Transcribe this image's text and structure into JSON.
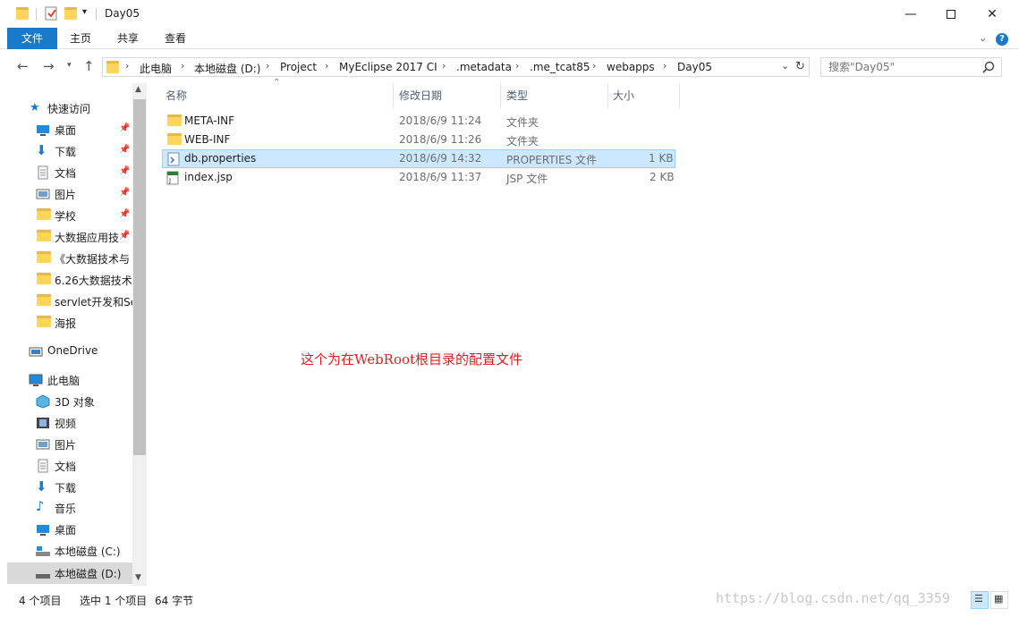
{
  "window": {
    "title": "Day05",
    "minimize_icon": "minimize-icon",
    "maximize_icon": "maximize-icon",
    "close_icon": "close-icon"
  },
  "ribbon": {
    "tabs": [
      {
        "label": "文件"
      },
      {
        "label": "主页"
      },
      {
        "label": "共享"
      },
      {
        "label": "查看"
      }
    ]
  },
  "address": {
    "crumbs": [
      "此电脑",
      "本地磁盘 (D:)",
      "Project",
      "MyEclipse 2017 CI",
      ".metadata",
      ".me_tcat85",
      "webapps",
      "Day05"
    ]
  },
  "search": {
    "placeholder": "搜索\"Day05\""
  },
  "sidebar": {
    "items": [
      {
        "label": "快速访问",
        "icon": "star-icon"
      },
      {
        "label": "桌面",
        "icon": "desktop-icon",
        "pinned": true
      },
      {
        "label": "下载",
        "icon": "download-icon",
        "pinned": true
      },
      {
        "label": "文档",
        "icon": "document-icon",
        "pinned": true
      },
      {
        "label": "图片",
        "icon": "picture-icon",
        "pinned": true
      },
      {
        "label": "学校",
        "icon": "folder-icon",
        "pinned": true
      },
      {
        "label": "大数据应用技",
        "icon": "folder-icon",
        "pinned": true
      },
      {
        "label": "《大数据技术与",
        "icon": "folder-icon"
      },
      {
        "label": "6.26大数据技术",
        "icon": "folder-icon"
      },
      {
        "label": "servlet开发和Se",
        "icon": "folder-icon"
      },
      {
        "label": "海报",
        "icon": "folder-icon"
      },
      {
        "label": "OneDrive",
        "icon": "cloud-icon"
      },
      {
        "label": "此电脑",
        "icon": "computer-icon"
      },
      {
        "label": "3D 对象",
        "icon": "cube-icon"
      },
      {
        "label": "视频",
        "icon": "video-icon"
      },
      {
        "label": "图片",
        "icon": "picture-icon"
      },
      {
        "label": "文档",
        "icon": "document-icon"
      },
      {
        "label": "下载",
        "icon": "download-icon"
      },
      {
        "label": "音乐",
        "icon": "music-icon"
      },
      {
        "label": "桌面",
        "icon": "desktop-icon"
      },
      {
        "label": "本地磁盘 (C:)",
        "icon": "drive-icon"
      },
      {
        "label": "本地磁盘 (D:)",
        "icon": "drive-icon"
      }
    ]
  },
  "columns": {
    "name": "名称",
    "modified": "修改日期",
    "type": "类型",
    "size": "大小"
  },
  "files": [
    {
      "name": "META-INF",
      "modified": "2018/6/9 11:24",
      "type": "文件夹",
      "size": ""
    },
    {
      "name": "WEB-INF",
      "modified": "2018/6/9 11:26",
      "type": "文件夹",
      "size": ""
    },
    {
      "name": "db.properties",
      "modified": "2018/6/9 14:32",
      "type": "PROPERTIES 文件",
      "size": "1 KB"
    },
    {
      "name": "index.jsp",
      "modified": "2018/6/9 11:37",
      "type": "JSP 文件",
      "size": "2 KB"
    }
  ],
  "annotation": "这个为在WebRoot根目录的配置文件",
  "status": {
    "count": "4 个项目",
    "selected": "选中 1 个项目",
    "bytes": "64 字节"
  },
  "watermark": "https://blog.csdn.net/qq_3359",
  "colors": {
    "accent": "#1979ca",
    "selection": "#cce8ff",
    "annotation": "#e02020"
  }
}
